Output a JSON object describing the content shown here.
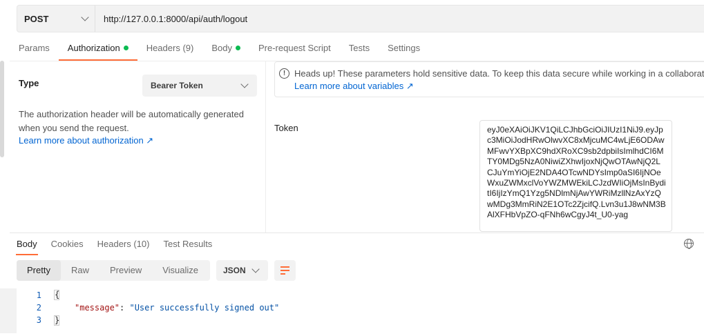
{
  "request": {
    "method": "POST",
    "url": "http://127.0.0.1:8000/api/auth/logout"
  },
  "request_tabs": [
    {
      "label": "Params"
    },
    {
      "label": "Authorization",
      "dot": true
    },
    {
      "label": "Headers",
      "count": "(9)"
    },
    {
      "label": "Body",
      "dot": true
    },
    {
      "label": "Pre-request Script"
    },
    {
      "label": "Tests"
    },
    {
      "label": "Settings"
    }
  ],
  "auth": {
    "type_label": "Type",
    "type_value": "Bearer Token",
    "description": "The authorization header will be automatically generated when you send the request.",
    "learn_link": "Learn more about authorization ↗",
    "notice": "Heads up! These parameters hold sensitive data. To keep this data secure while working in a collaborativ",
    "notice_link": "Learn more about variables ↗",
    "token_label": "Token",
    "token_value": "eyJ0eXAiOiJKV1QiLCJhbGciOiJIUzI1NiJ9.eyJpc3MiOiJodHRwOlwvXC8xMjcuMC4wLjE6ODAwMFwvYXBpXC9hdXRoXC9sb2dpbiIsImlhdCI6MTY0MDg5NzA0NiwiZXhwIjoxNjQwOTAwNjQ2LCJuYmYiOjE2NDA4OTcwNDYsImp0aSI6IjNOeWxuZWMxclVoYWZMWEkiLCJzdWIiOjMsInByditI6IjIzYmQ1Yzg5NDlmNjAwYWRiMzllNzAxYzQwMDg3MmRiN2E1OTc2ZjcifQ.Lvn3u1J8wNM3BAlXFHbVpZO-qFNh6wCgyJ4t_U0-yag"
  },
  "response": {
    "tabs": [
      {
        "label": "Body"
      },
      {
        "label": "Cookies"
      },
      {
        "label": "Headers",
        "count": "(10)"
      },
      {
        "label": "Test Results"
      }
    ],
    "views": [
      "Pretty",
      "Raw",
      "Preview",
      "Visualize"
    ],
    "format": "JSON",
    "lines": [
      "1",
      "2",
      "3"
    ],
    "open_brace": "{",
    "close_brace": "}",
    "key": "\"message\"",
    "colon": ": ",
    "value": "\"User successfully signed out\""
  },
  "colors": {
    "accent": "#ff6c37",
    "link": "#0265d2",
    "dot": "#0cbb52"
  },
  "icons": [
    "chevron-down-icon",
    "info-icon",
    "globe-icon",
    "wrap-lines-icon"
  ]
}
